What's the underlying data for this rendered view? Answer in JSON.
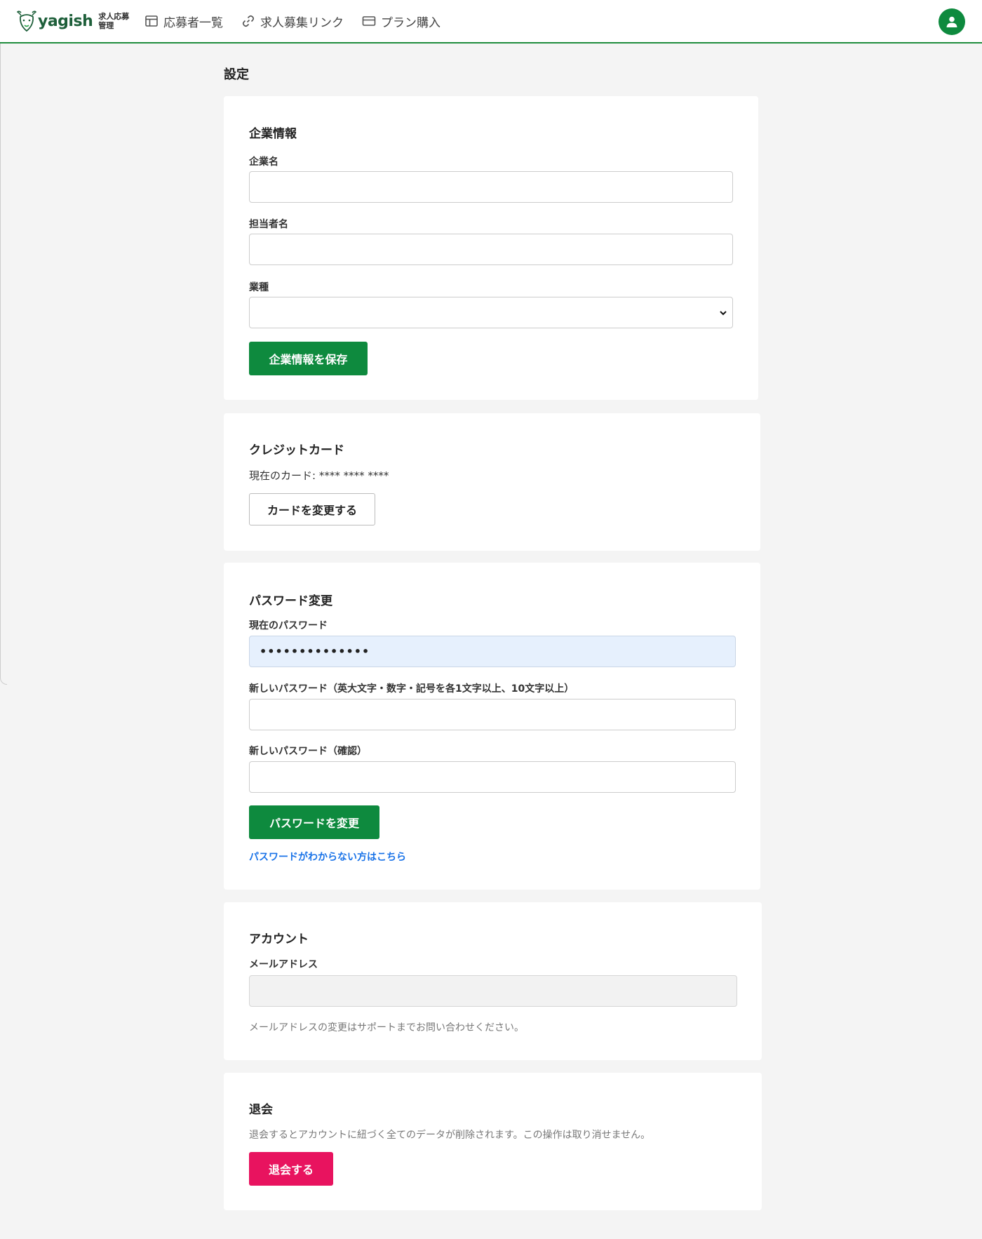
{
  "header": {
    "logo_text": "yagish",
    "logo_sub_line1": "求人応募",
    "logo_sub_line2": "管理",
    "nav": [
      {
        "label": "応募者一覧",
        "icon": "layout-icon"
      },
      {
        "label": "求人募集リンク",
        "icon": "link-icon"
      },
      {
        "label": "プラン購入",
        "icon": "credit-card-icon"
      }
    ],
    "brand_color": "#0e8a3e"
  },
  "page": {
    "title": "設定"
  },
  "company": {
    "heading": "企業情報",
    "name_label": "企業名",
    "name_value": "",
    "contact_label": "担当者名",
    "contact_value": "",
    "industry_label": "業種",
    "industry_value": "",
    "save_button": "企業情報を保存"
  },
  "credit_card": {
    "heading": "クレジットカード",
    "current_card": "現在のカード: **** **** ****",
    "change_button": "カードを変更する"
  },
  "password": {
    "heading": "パスワード変更",
    "current_label": "現在のパスワード",
    "current_value": "••••••••••••••",
    "new_label": "新しいパスワード（英大文字・数字・記号を各1文字以上、10文字以上）",
    "new_value": "",
    "confirm_label": "新しいパスワード（確認）",
    "confirm_value": "",
    "change_button": "パスワードを変更",
    "forgot_link": "パスワードがわからない方はこちら"
  },
  "account": {
    "heading": "アカウント",
    "email_label": "メールアドレス",
    "email_value": "",
    "note": "メールアドレスの変更はサポートまでお問い合わせください。"
  },
  "withdraw": {
    "heading": "退会",
    "warning": "退会するとアカウントに紐づく全てのデータが削除されます。この操作は取り消せません。",
    "button": "退会する",
    "danger_color": "#e8135f"
  }
}
